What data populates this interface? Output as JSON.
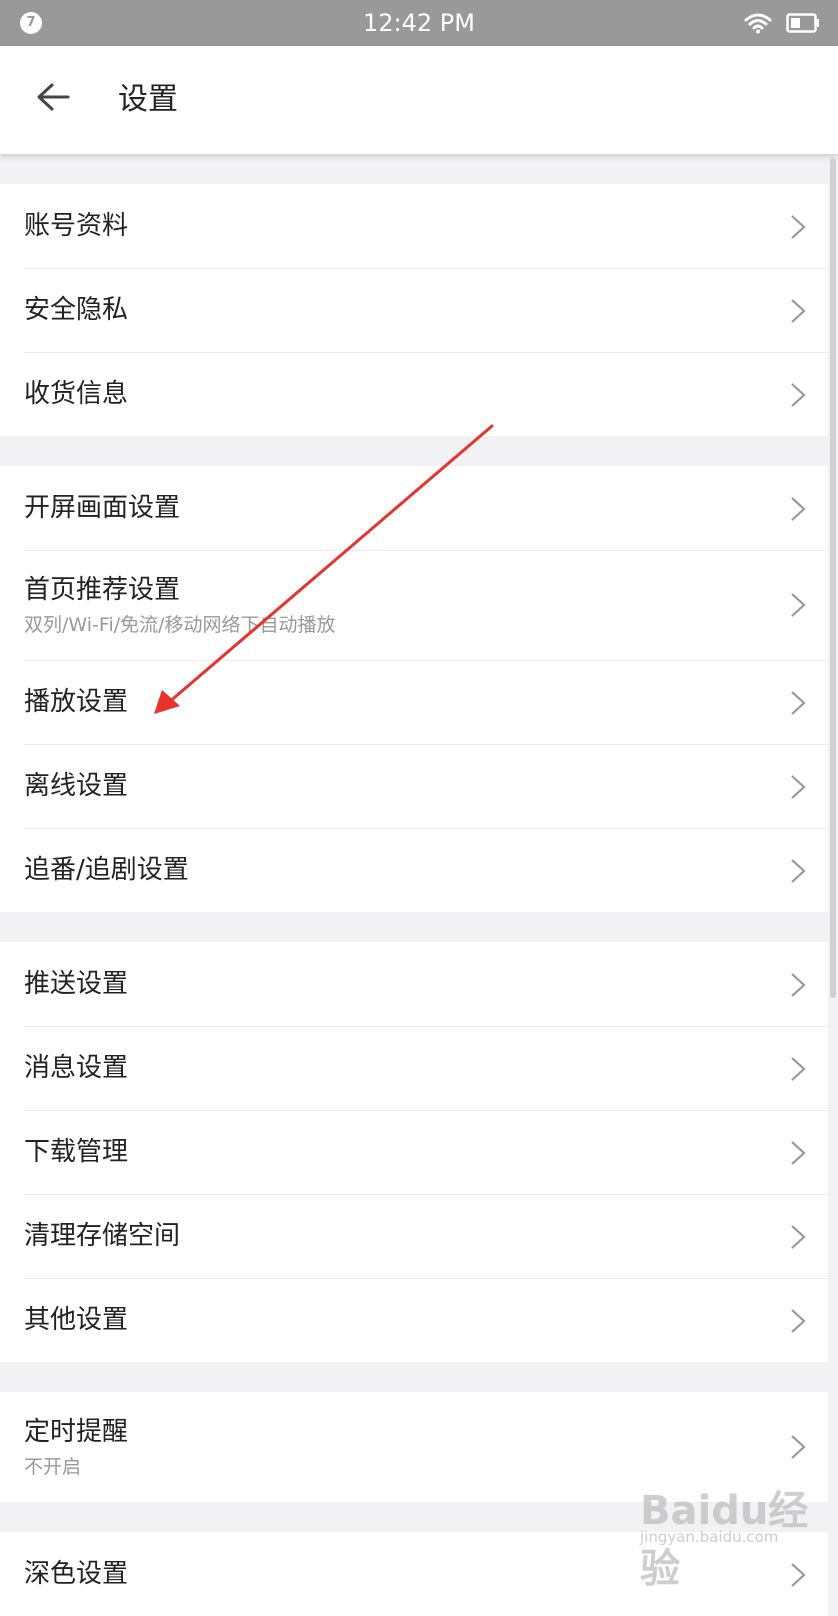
{
  "status_bar": {
    "badge": "7",
    "time": "12:42 PM",
    "wifi_icon": "wifi-icon",
    "battery_icon": "battery-icon"
  },
  "header": {
    "back_icon": "arrow-left-icon",
    "title": "设置"
  },
  "groups": [
    {
      "items": [
        {
          "label": "账号资料"
        },
        {
          "label": "安全隐私"
        },
        {
          "label": "收货信息"
        }
      ]
    },
    {
      "items": [
        {
          "label": "开屏画面设置"
        },
        {
          "label": "首页推荐设置",
          "sub": "双列/Wi-Fi/免流/移动网络下自动播放"
        },
        {
          "label": "播放设置"
        },
        {
          "label": "离线设置"
        },
        {
          "label": "追番/追剧设置"
        }
      ]
    },
    {
      "items": [
        {
          "label": "推送设置"
        },
        {
          "label": "消息设置"
        },
        {
          "label": "下载管理"
        },
        {
          "label": "清理存储空间"
        },
        {
          "label": "其他设置"
        }
      ]
    },
    {
      "items": [
        {
          "label": "定时提醒",
          "sub": "不开启"
        }
      ]
    },
    {
      "items": [
        {
          "label": "深色设置"
        }
      ]
    }
  ],
  "annotation": {
    "color": "#e8322c"
  },
  "watermark": {
    "text": "Baidu经验",
    "sub": "jingyan.baidu.com"
  }
}
